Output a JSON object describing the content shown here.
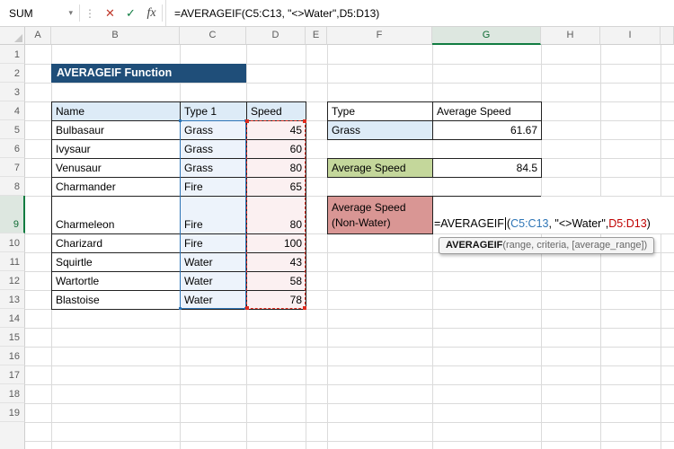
{
  "formula_bar": {
    "name_box": "SUM",
    "dropdown_glyph": "▾",
    "handle_glyph": "⋮",
    "cancel_glyph": "✕",
    "enter_glyph": "✓",
    "fx_glyph": "fx",
    "formula": "=AVERAGEIF(C5:C13, \"<>Water\",D5:D13)"
  },
  "grid": {
    "col_labels": [
      "A",
      "B",
      "C",
      "D",
      "E",
      "F",
      "G",
      "H",
      "I"
    ],
    "row_labels": [
      "1",
      "2",
      "3",
      "4",
      "5",
      "6",
      "7",
      "8",
      "9",
      "10",
      "11",
      "12",
      "13",
      "14",
      "15",
      "16",
      "17",
      "18",
      "19"
    ]
  },
  "title_cell": {
    "text": "AVERAGEIF Function"
  },
  "pokemon_table": {
    "headers": [
      "Name",
      "Type 1",
      "Speed"
    ],
    "rows": [
      {
        "name": "Bulbasaur",
        "type": "Grass",
        "speed": "45"
      },
      {
        "name": "Ivysaur",
        "type": "Grass",
        "speed": "60"
      },
      {
        "name": "Venusaur",
        "type": "Grass",
        "speed": "80"
      },
      {
        "name": "Charmander",
        "type": "Fire",
        "speed": "65"
      },
      {
        "name": "Charmeleon",
        "type": "Fire",
        "speed": "80"
      },
      {
        "name": "Charizard",
        "type": "Fire",
        "speed": "100"
      },
      {
        "name": "Squirtle",
        "type": "Water",
        "speed": "43"
      },
      {
        "name": "Wartortle",
        "type": "Water",
        "speed": "58"
      },
      {
        "name": "Blastoise",
        "type": "Water",
        "speed": "78"
      }
    ]
  },
  "summary": {
    "type_header": "Type",
    "avg_speed_header": "Average Speed",
    "grass_type": "Grass",
    "grass_avg": "61.67",
    "avg_speed_label": "Average Speed",
    "avg_speed_value": "84.5",
    "nonwater_line1": "Average Speed",
    "nonwater_line2": "(Non-Water)"
  },
  "cell_formula": {
    "fn": "=AVERAGEIF",
    "open": "(",
    "range1": "C5:C13",
    "criteria": ", \"<>Water\",",
    "range2": "D5:D13",
    "close": ")"
  },
  "tooltip": {
    "fn": "AVERAGEIF",
    "args": "(range, criteria, [average_range])"
  },
  "colors": {
    "title_bg": "#1F4E79",
    "table_header_fill": "#DDEBF7",
    "green_fill": "#C4D79B",
    "rose_fill": "#D99694",
    "ref_blue": "#2E75B6",
    "ref_red": "#C00000",
    "selection_green": "#107C41"
  }
}
